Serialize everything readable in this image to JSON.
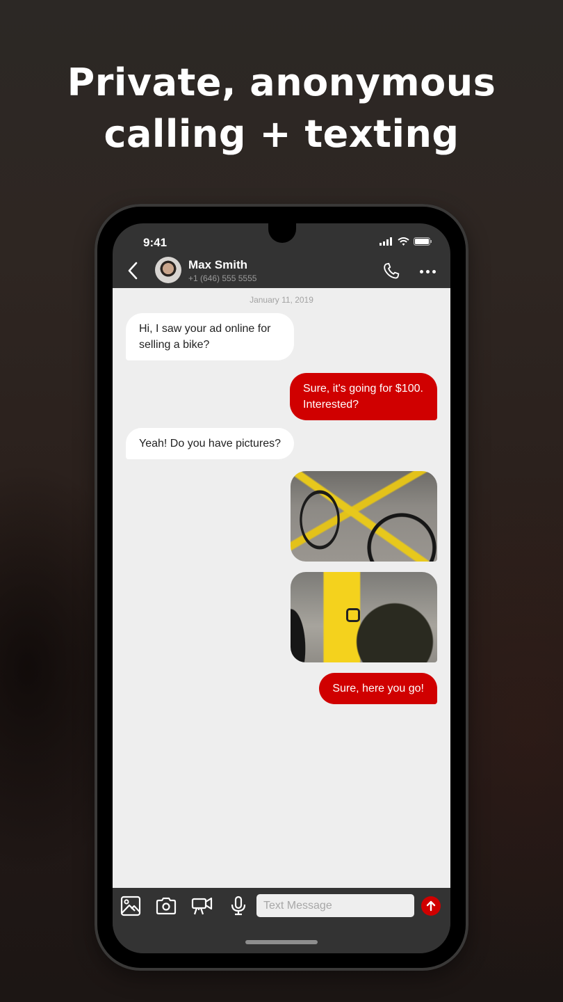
{
  "headline": {
    "line1": "Private, anonymous",
    "line2": "calling + texting"
  },
  "status_bar": {
    "time": "9:41",
    "icons": [
      "signal-icon",
      "wifi-icon",
      "battery-icon"
    ]
  },
  "header": {
    "back_icon": "chevron-left-icon",
    "contact_name": "Max Smith",
    "contact_number": "+1 (646) 555 5555",
    "call_icon": "phone-icon",
    "more_icon": "more-horizontal-icon"
  },
  "chat": {
    "date": "January 11, 2019",
    "messages": [
      {
        "direction": "incoming",
        "type": "text",
        "text": "Hi, I saw your ad online for selling a bike?"
      },
      {
        "direction": "outgoing",
        "type": "text",
        "text": "Sure, it's going for $100. Interested?"
      },
      {
        "direction": "incoming",
        "type": "text",
        "text": "Yeah! Do you have pictures?"
      },
      {
        "direction": "outgoing",
        "type": "image",
        "alt": "Yellow bicycle parked at a bike rack"
      },
      {
        "direction": "outgoing",
        "type": "image",
        "alt": "Close-up of yellow bicycle frame and chainring"
      },
      {
        "direction": "outgoing",
        "type": "text",
        "text": "Sure, here you go!"
      }
    ]
  },
  "composer": {
    "tools": [
      "image-gallery-icon",
      "camera-icon",
      "video-camera-icon",
      "microphone-icon"
    ],
    "placeholder": "Text Message",
    "value": "",
    "send_icon": "arrow-up-icon"
  },
  "colors": {
    "accent": "#d00000",
    "chat_bg": "#eeeeee",
    "bar_bg": "#333333",
    "incoming_bubble": "#ffffff"
  }
}
